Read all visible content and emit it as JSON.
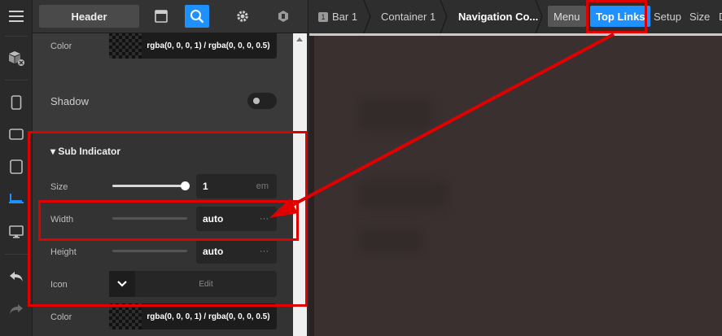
{
  "rail": {
    "icons": [
      "menu-icon",
      "add-element-icon",
      "mobile-icon",
      "tablet-landscape-icon",
      "tablet-icon",
      "laptop-icon",
      "desktop-icon",
      "undo-icon",
      "redo-icon"
    ],
    "active_icon": "laptop-icon"
  },
  "toolbar": {
    "header_label": "Header",
    "icons": [
      "window-icon",
      "search-icon",
      "gear-icon",
      "plugin-icon"
    ],
    "active_icon": "search-icon"
  },
  "breadcrumb": {
    "items": [
      {
        "label": "Bar 1",
        "badge": "1"
      },
      {
        "label": "Container 1"
      },
      {
        "label": "Navigation Co..."
      }
    ]
  },
  "tabs": [
    "Menu",
    "Top Links",
    "Setup",
    "Size",
    "D"
  ],
  "selected_tab": "Top Links",
  "panel": {
    "color_top": {
      "label": "Color",
      "value": "rgba(0, 0, 0, 1) / rgba(0, 0, 0, 0.5)"
    },
    "shadow": {
      "label": "Shadow",
      "enabled": false
    },
    "sub_indicator": {
      "title": "Sub Indicator",
      "size": {
        "label": "Size",
        "value": "1",
        "unit": "em",
        "slider_fraction": 1.0
      },
      "width": {
        "label": "Width",
        "value": "auto",
        "more": "···"
      },
      "height": {
        "label": "Height",
        "value": "auto",
        "more": "···"
      },
      "icon": {
        "label": "Icon",
        "edit": "Edit"
      },
      "color": {
        "label": "Color",
        "value": "rgba(0, 0, 0, 1) / rgba(0, 0, 0, 0.5)"
      }
    }
  },
  "colors": {
    "accent": "#1e90ff",
    "annotation": "#e00000"
  }
}
